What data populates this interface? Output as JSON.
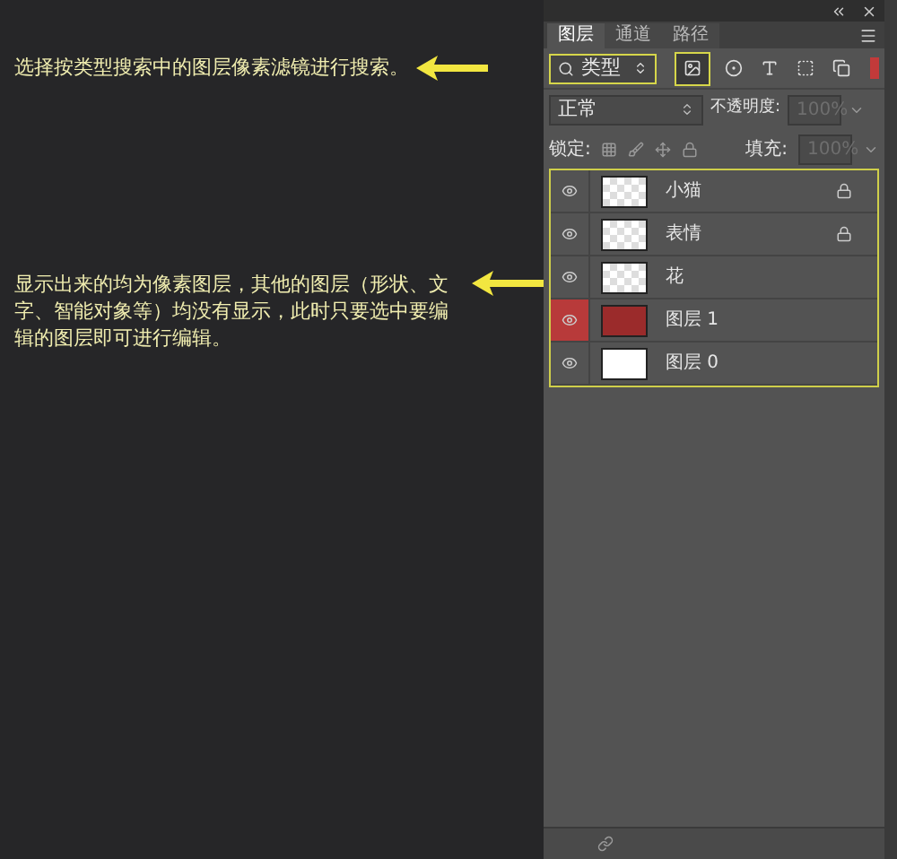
{
  "annotations": [
    {
      "text": "选择按类型搜索中的图层像素滤镜进行搜索。"
    },
    {
      "text": "显示出来的均为像素图层，其他的图层（形状、文字、智能对象等）均没有显示，此时只要选中要编辑的图层即可进行编辑。"
    }
  ],
  "tabs": [
    {
      "label": "图层",
      "selected": true
    },
    {
      "label": "通道",
      "selected": false
    },
    {
      "label": "路径",
      "selected": false
    }
  ],
  "filter": {
    "value": "类型"
  },
  "blend_mode": {
    "value": "正常"
  },
  "opacity": {
    "label": "不透明度:",
    "value": "100%",
    "disabled": true
  },
  "lock": {
    "label": "锁定:"
  },
  "fill": {
    "label": "填充:",
    "value": "100%",
    "disabled": true
  },
  "layers": [
    {
      "name": "小猫",
      "kind": "transparent",
      "locked": true,
      "selected": false
    },
    {
      "name": "表情",
      "kind": "transparent",
      "locked": true,
      "selected": false
    },
    {
      "name": "花",
      "kind": "transparent",
      "locked": false,
      "selected": false
    },
    {
      "name": "图层 1",
      "kind": "red",
      "locked": false,
      "selected": true
    },
    {
      "name": "图层 0",
      "kind": "white",
      "locked": false,
      "selected": false
    }
  ]
}
